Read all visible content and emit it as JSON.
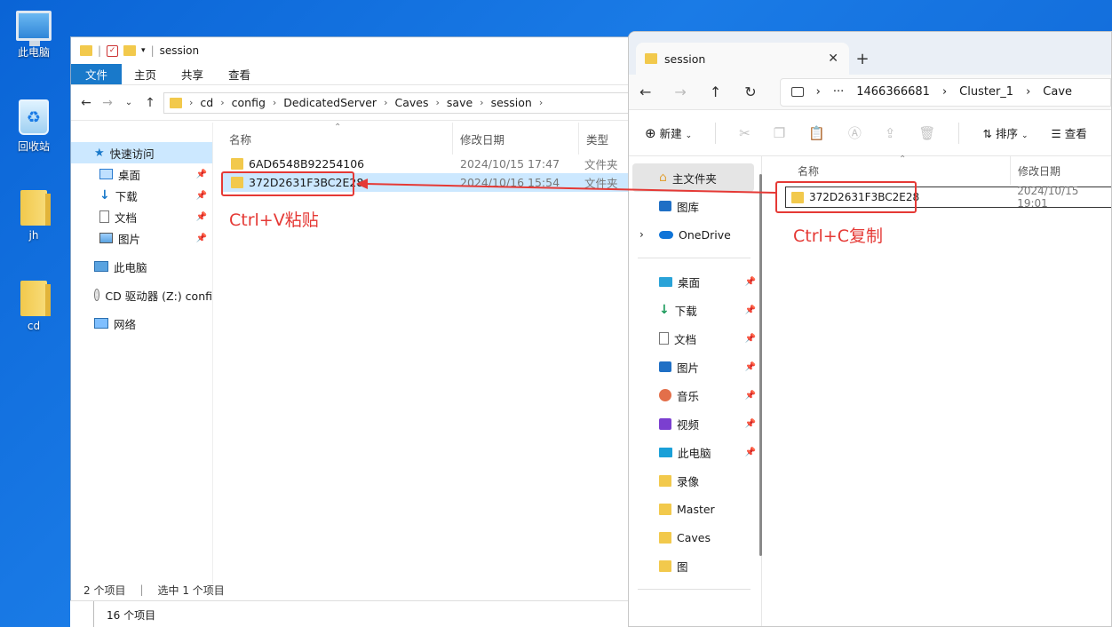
{
  "desktop": {
    "icons": [
      {
        "label": "此电脑",
        "icon": "computer-icon"
      },
      {
        "label": "回收站",
        "icon": "recycle-bin-icon"
      },
      {
        "label": "jh",
        "icon": "folder-icon"
      },
      {
        "label": "cd",
        "icon": "folder-icon"
      }
    ]
  },
  "left_window": {
    "title": "session",
    "ribbon_tabs": [
      "文件",
      "主页",
      "共享",
      "查看"
    ],
    "breadcrumb": [
      "cd",
      "config",
      "DedicatedServer",
      "Caves",
      "save",
      "session"
    ],
    "sidebar": [
      {
        "label": "快速访问",
        "icon": "star-icon",
        "pinned": false
      },
      {
        "label": "桌面",
        "icon": "desktop-icon",
        "pinned": true
      },
      {
        "label": "下载",
        "icon": "download-icon",
        "pinned": true
      },
      {
        "label": "文档",
        "icon": "document-icon",
        "pinned": true
      },
      {
        "label": "图片",
        "icon": "pictures-icon",
        "pinned": true
      },
      {
        "label": "此电脑",
        "icon": "computer-icon",
        "pinned": false
      },
      {
        "label": "CD 驱动器 (Z:) confi",
        "icon": "cd-drive-icon",
        "pinned": false
      },
      {
        "label": "网络",
        "icon": "network-icon",
        "pinned": false
      }
    ],
    "columns": [
      "名称",
      "修改日期",
      "类型"
    ],
    "files": [
      {
        "name": "6AD6548B92254106",
        "date": "2024/10/15 17:47",
        "type": "文件夹",
        "selected": false
      },
      {
        "name": "372D2631F3BC2E28",
        "date": "2024/10/16 15:54",
        "type": "文件夹",
        "selected": true
      }
    ],
    "annotation": "Ctrl+V粘贴",
    "status": {
      "count": "2 个项目",
      "selected": "选中 1 个项目"
    },
    "bottom_strip": "16 个项目"
  },
  "right_window": {
    "tab_title": "session",
    "address": [
      "1466366681",
      "Cluster_1",
      "Cave"
    ],
    "address_more": "···",
    "commands": {
      "new": "新建",
      "sort": "排序",
      "view": "查看"
    },
    "sidebar_top": [
      {
        "label": "主文件夹",
        "icon": "home-icon"
      },
      {
        "label": "图库",
        "icon": "gallery-icon"
      },
      {
        "label": "OneDrive",
        "icon": "onedrive-icon"
      }
    ],
    "sidebar_bottom": [
      {
        "label": "桌面",
        "icon": "desktop-icon",
        "pinned": true
      },
      {
        "label": "下载",
        "icon": "download-icon",
        "pinned": true
      },
      {
        "label": "文档",
        "icon": "document-icon",
        "pinned": true
      },
      {
        "label": "图片",
        "icon": "pictures-icon",
        "pinned": true
      },
      {
        "label": "音乐",
        "icon": "music-icon",
        "pinned": true
      },
      {
        "label": "视频",
        "icon": "video-icon",
        "pinned": true
      },
      {
        "label": "此电脑",
        "icon": "computer-icon",
        "pinned": true
      },
      {
        "label": "录像",
        "icon": "folder-icon",
        "pinned": false
      },
      {
        "label": "Master",
        "icon": "folder-icon",
        "pinned": false
      },
      {
        "label": "Caves",
        "icon": "folder-icon",
        "pinned": false
      },
      {
        "label": "图",
        "icon": "folder-icon",
        "pinned": false
      }
    ],
    "columns": [
      "名称",
      "修改日期"
    ],
    "files": [
      {
        "name": "372D2631F3BC2E28",
        "date": "2024/10/15 19:01"
      }
    ],
    "annotation": "Ctrl+C复制"
  },
  "colors": {
    "accent": "#1979ca",
    "annotation": "#e53935",
    "selection": "#cce8ff",
    "desktop": "#0a64d6"
  }
}
